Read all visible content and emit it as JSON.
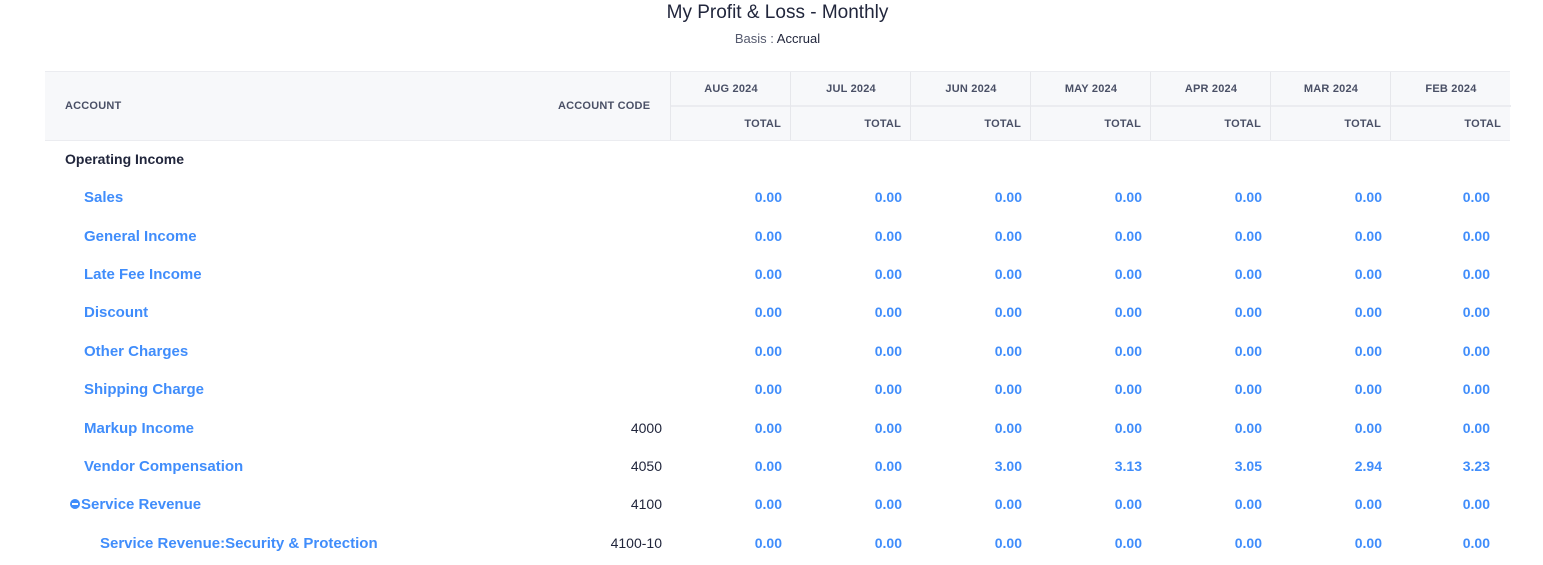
{
  "report": {
    "title": "My Profit & Loss - Monthly",
    "basis_label": "Basis",
    "basis_sep": " : ",
    "basis_value": "Accrual"
  },
  "header": {
    "account": "ACCOUNT",
    "account_code": "ACCOUNT CODE",
    "months": [
      "AUG 2024",
      "JUL 2024",
      "JUN 2024",
      "MAY 2024",
      "APR 2024",
      "MAR 2024",
      "FEB 2024"
    ],
    "total_label": "TOTAL"
  },
  "rows": [
    {
      "type": "group",
      "name": "Operating Income"
    },
    {
      "type": "account",
      "name": "Sales",
      "code": "",
      "values": [
        "0.00",
        "0.00",
        "0.00",
        "0.00",
        "0.00",
        "0.00",
        "0.00"
      ]
    },
    {
      "type": "account",
      "name": "General Income",
      "code": "",
      "values": [
        "0.00",
        "0.00",
        "0.00",
        "0.00",
        "0.00",
        "0.00",
        "0.00"
      ]
    },
    {
      "type": "account",
      "name": "Late Fee Income",
      "code": "",
      "values": [
        "0.00",
        "0.00",
        "0.00",
        "0.00",
        "0.00",
        "0.00",
        "0.00"
      ]
    },
    {
      "type": "account",
      "name": "Discount",
      "code": "",
      "values": [
        "0.00",
        "0.00",
        "0.00",
        "0.00",
        "0.00",
        "0.00",
        "0.00"
      ]
    },
    {
      "type": "account",
      "name": "Other Charges",
      "code": "",
      "values": [
        "0.00",
        "0.00",
        "0.00",
        "0.00",
        "0.00",
        "0.00",
        "0.00"
      ]
    },
    {
      "type": "account",
      "name": "Shipping Charge",
      "code": "",
      "values": [
        "0.00",
        "0.00",
        "0.00",
        "0.00",
        "0.00",
        "0.00",
        "0.00"
      ]
    },
    {
      "type": "account",
      "name": "Markup Income",
      "code": "4000",
      "values": [
        "0.00",
        "0.00",
        "0.00",
        "0.00",
        "0.00",
        "0.00",
        "0.00"
      ]
    },
    {
      "type": "account",
      "name": "Vendor Compensation",
      "code": "4050",
      "values": [
        "0.00",
        "0.00",
        "3.00",
        "3.13",
        "3.05",
        "2.94",
        "3.23"
      ]
    },
    {
      "type": "parent",
      "name": "Service Revenue",
      "code": "4100",
      "icon": "collapse-minus-icon",
      "values": [
        "0.00",
        "0.00",
        "0.00",
        "0.00",
        "0.00",
        "0.00",
        "0.00"
      ]
    },
    {
      "type": "child",
      "name": "Service Revenue:Security & Protection",
      "code": "4100-10",
      "values": [
        "0.00",
        "0.00",
        "0.00",
        "0.00",
        "0.00",
        "0.00",
        "0.00"
      ]
    }
  ]
}
